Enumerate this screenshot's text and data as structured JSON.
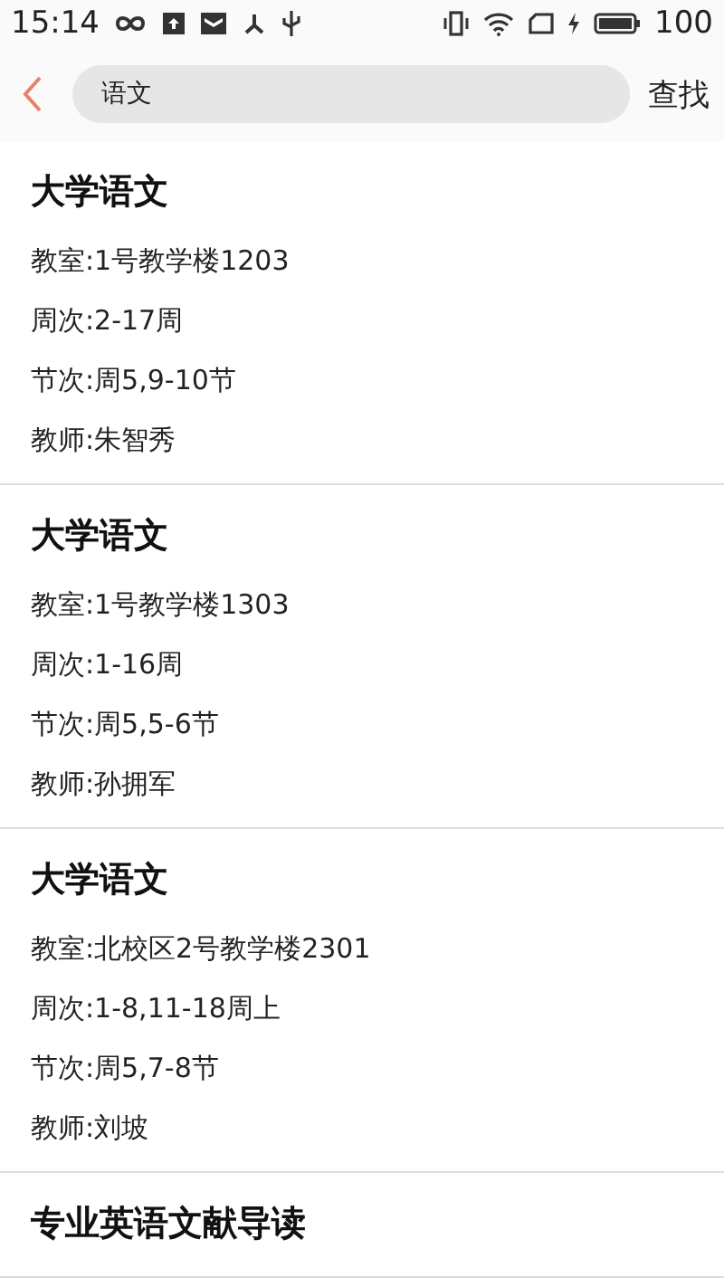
{
  "status_bar": {
    "time": "15:14",
    "battery": "100"
  },
  "header": {
    "search": {
      "value": "语文"
    },
    "action": "查找"
  },
  "results": [
    {
      "title": "大学语文",
      "lines": [
        "教室:1号教学楼1203",
        "周次:2-17周",
        "节次:周5,9-10节",
        "教师:朱智秀"
      ]
    },
    {
      "title": "大学语文",
      "lines": [
        "教室:1号教学楼1303",
        "周次:1-16周",
        "节次:周5,5-6节",
        "教师:孙拥军"
      ]
    },
    {
      "title": "大学语文",
      "lines": [
        "教室:北校区2号教学楼2301",
        "周次:1-8,11-18周上",
        "节次:周5,7-8节",
        "教师:刘坡"
      ]
    },
    {
      "title": "专业英语文献导读"
    }
  ]
}
